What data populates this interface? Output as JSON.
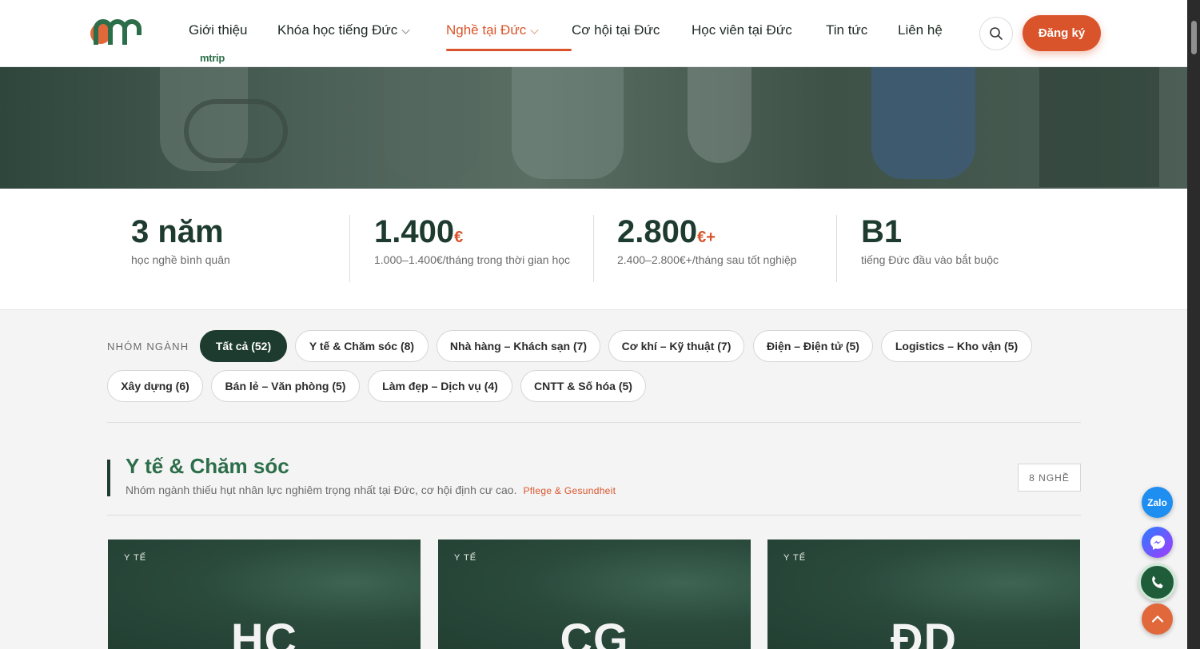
{
  "header": {
    "logo_text": "mtrip",
    "nav": [
      {
        "label": "Giới thiệu",
        "has_dropdown": false,
        "active": false
      },
      {
        "label": "Khóa học tiếng Đức",
        "has_dropdown": true,
        "active": false
      },
      {
        "label": "Nghề tại Đức",
        "has_dropdown": true,
        "active": true
      },
      {
        "label": "Cơ hội tại Đức",
        "has_dropdown": false,
        "active": false
      },
      {
        "label": "Học viên tại Đức",
        "has_dropdown": false,
        "active": false
      },
      {
        "label": "Tin tức",
        "has_dropdown": false,
        "active": false
      },
      {
        "label": "Liên hệ",
        "has_dropdown": false,
        "active": false
      }
    ],
    "search_icon": "search-icon",
    "register_label": "Đăng ký"
  },
  "stats": [
    {
      "value": "3 năm",
      "unit": "",
      "desc": "học nghề bình quân"
    },
    {
      "value": "1.400",
      "unit": "€",
      "desc": "1.000–1.400€/tháng trong thời gian học"
    },
    {
      "value": "2.800",
      "unit": "€+",
      "desc": "2.400–2.800€+/tháng sau tốt nghiệp"
    },
    {
      "value": "B1",
      "unit": "",
      "desc": "tiếng Đức đầu vào bắt buộc"
    }
  ],
  "filters": {
    "label": "NHÓM NGÀNH",
    "chips": [
      "Tất cả (52)",
      "Y tế & Chăm sóc (8)",
      "Nhà hàng – Khách sạn (7)",
      "Cơ khí – Kỹ thuật (7)",
      "Điện – Điện tử (5)",
      "Logistics – Kho vận (5)",
      "Xây dựng (6)",
      "Bán lẻ – Văn phòng (5)",
      "Làm đẹp – Dịch vụ (4)",
      "CNTT & Số hóa (5)"
    ],
    "active_index": 0
  },
  "section": {
    "title": "Y tế & Chăm sóc",
    "subtitle": "Nhóm ngành thiếu hụt nhân lực nghiêm trọng nhất tại Đức, cơ hội định cư cao.",
    "tag": "Pflege & Gesundheit",
    "count": "8 NGHỀ"
  },
  "cards": [
    {
      "category": "Y TẾ",
      "code": "HC"
    },
    {
      "category": "Y TẾ",
      "code": "CG"
    },
    {
      "category": "Y TẾ",
      "code": "ĐD"
    }
  ],
  "floating": {
    "zalo_label": "Zalo",
    "icons": [
      "zalo-icon",
      "messenger-icon",
      "phone-icon",
      "arrow-up-icon"
    ]
  },
  "colors": {
    "accent": "#d9542b",
    "brand_dark": "#1e3b2f",
    "brand_green": "#2c6e49"
  }
}
